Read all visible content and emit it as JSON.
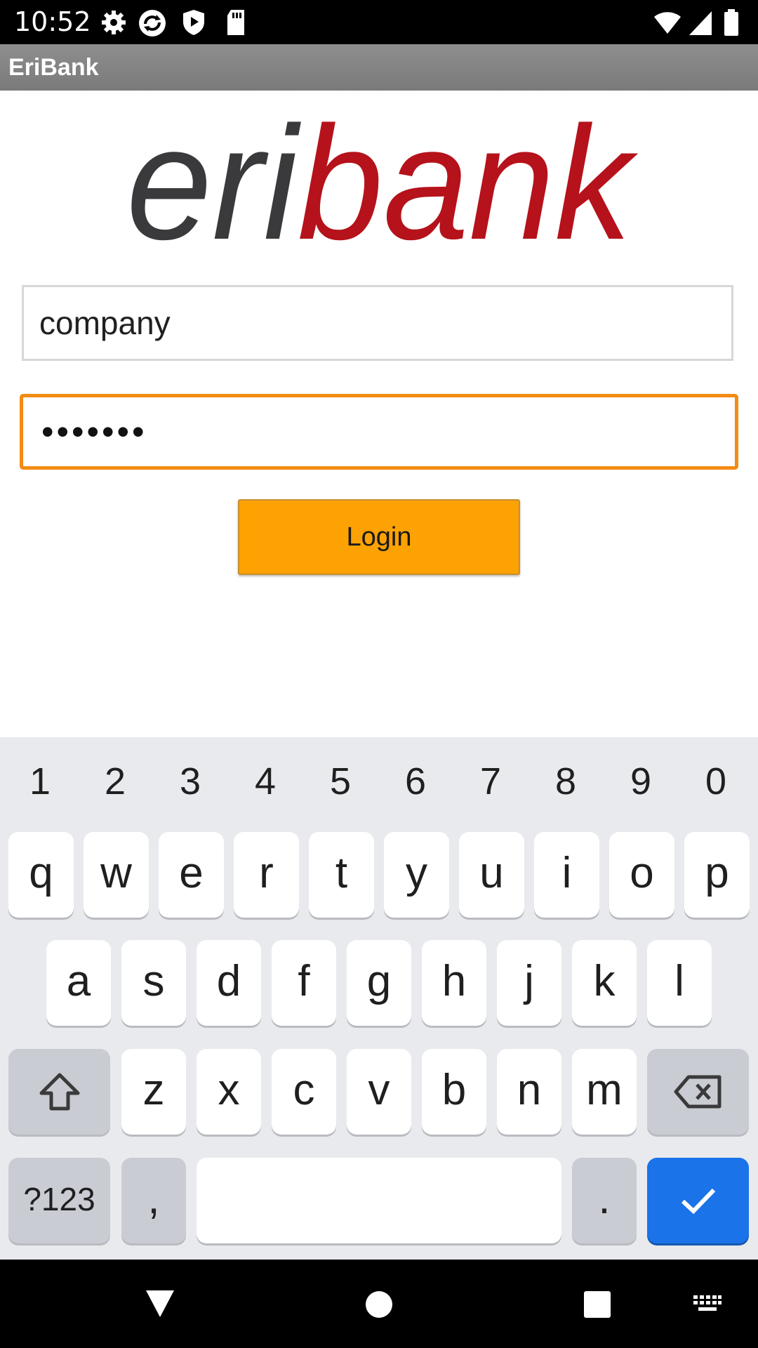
{
  "status_bar": {
    "time": "10:52",
    "left_icons": [
      "gear-icon",
      "sync-icon",
      "play-protect-icon",
      "sd-card-icon"
    ],
    "right_icons": [
      "wifi-icon",
      "signal-icon",
      "battery-icon"
    ]
  },
  "app_bar": {
    "title": "EriBank"
  },
  "logo": {
    "part1": "eri",
    "part2": "bank",
    "color1": "#3a3a3c",
    "color2": "#b5121b"
  },
  "form": {
    "username_value": "company",
    "password_value": "•••••••",
    "login_label": "Login",
    "accent_color": "#f28c14",
    "button_color": "#fca203"
  },
  "keyboard": {
    "number_row": [
      "1",
      "2",
      "3",
      "4",
      "5",
      "6",
      "7",
      "8",
      "9",
      "0"
    ],
    "row1": [
      "q",
      "w",
      "e",
      "r",
      "t",
      "y",
      "u",
      "i",
      "o",
      "p"
    ],
    "row2": [
      "a",
      "s",
      "d",
      "f",
      "g",
      "h",
      "j",
      "k",
      "l"
    ],
    "row3": [
      "z",
      "x",
      "c",
      "v",
      "b",
      "n",
      "m"
    ],
    "symbols_label": "?123",
    "comma": ",",
    "period": ".",
    "shift_icon": "shift-icon",
    "backspace_icon": "backspace-icon",
    "enter_icon": "checkmark-icon"
  },
  "nav_bar": {
    "icons": [
      "back-icon",
      "home-icon",
      "recents-icon",
      "keyboard-switch-icon"
    ]
  }
}
